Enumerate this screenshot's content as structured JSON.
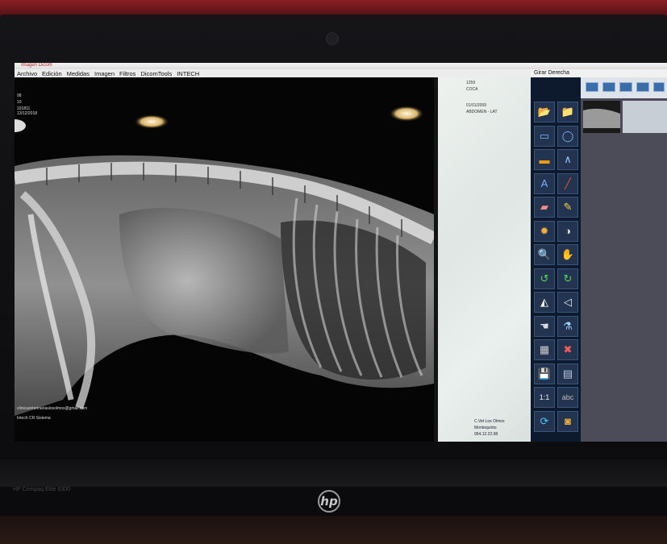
{
  "window": {
    "title": "Imagen Dicom"
  },
  "menu": {
    "items": [
      "Archivo",
      "Edición",
      "Medidas",
      "Imagen",
      "Filtros",
      "DicomTools",
      "INTECH"
    ]
  },
  "right_header": "Girar Derecha",
  "xray": {
    "overlay_top_left": [
      "98",
      "10",
      "191811",
      "13/12/2018"
    ],
    "overlay_bottom_left": [
      "clinicaveterinariaslosolmos@gmail.com",
      "Intech CR Sistema"
    ]
  },
  "panel": {
    "top": [
      "1259",
      "COCA"
    ],
    "mid": [
      "01/01/2009",
      "ABDOMEN - LAT"
    ],
    "footer": [
      "C.Vet Los Olmos",
      "Montequinto",
      "954.12.22.98"
    ]
  },
  "tools": [
    {
      "name": "open-folder-icon",
      "glyph": "📂",
      "color": "#e8b84a"
    },
    {
      "name": "folder-icon",
      "glyph": "📁",
      "color": "#f0c24a"
    },
    {
      "name": "rect-select-icon",
      "glyph": "▭",
      "color": "#7fb2ff"
    },
    {
      "name": "ellipse-select-icon",
      "glyph": "◯",
      "color": "#7fb2ff"
    },
    {
      "name": "ruler-icon",
      "glyph": "▬",
      "color": "#f39c12"
    },
    {
      "name": "angle-icon",
      "glyph": "∧",
      "color": "#9fc6ff"
    },
    {
      "name": "text-icon",
      "glyph": "A",
      "color": "#7fb2ff"
    },
    {
      "name": "pencil-icon",
      "glyph": "╱",
      "color": "#e74c3c"
    },
    {
      "name": "eraser-icon",
      "glyph": "▰",
      "color": "#f28c8c"
    },
    {
      "name": "brush-icon",
      "glyph": "✎",
      "color": "#f5d04a"
    },
    {
      "name": "contrast-icon",
      "glyph": "✹",
      "color": "#f5b041"
    },
    {
      "name": "brightness-icon",
      "glyph": "◑",
      "color": "#e0e0e0"
    },
    {
      "name": "zoom-icon",
      "glyph": "🔍",
      "color": "#ddd"
    },
    {
      "name": "pan-icon",
      "glyph": "✋",
      "color": "#eee"
    },
    {
      "name": "rotate-left-icon",
      "glyph": "↺",
      "color": "#5cd65c"
    },
    {
      "name": "rotate-right-icon",
      "glyph": "↻",
      "color": "#5cd65c"
    },
    {
      "name": "flip-vertical-icon",
      "glyph": "◭",
      "color": "#eee"
    },
    {
      "name": "flip-horizontal-icon",
      "glyph": "◁",
      "color": "#eee"
    },
    {
      "name": "hand-tool-icon",
      "glyph": "☚",
      "color": "#ddd"
    },
    {
      "name": "filter-icon",
      "glyph": "⚗",
      "color": "#9fd0ff"
    },
    {
      "name": "image-grid-icon",
      "glyph": "▦",
      "color": "#ccc"
    },
    {
      "name": "close-icon",
      "glyph": "✖",
      "color": "#ff5a5a"
    },
    {
      "name": "save-icon",
      "glyph": "💾",
      "color": "#6fa8ff"
    },
    {
      "name": "export-icon",
      "glyph": "▤",
      "color": "#bfcbe0"
    },
    {
      "name": "actual-size-icon",
      "glyph": "1:1",
      "color": "#eee"
    },
    {
      "name": "annotation-icon",
      "glyph": "abc",
      "color": "#bbb"
    },
    {
      "name": "refresh-icon",
      "glyph": "⟳",
      "color": "#4fc3ff"
    },
    {
      "name": "dicom-icon",
      "glyph": "◙",
      "color": "#f5b041"
    }
  ],
  "monitor": {
    "brand": "HP Compaq Elite 8300",
    "logo": "hp"
  }
}
